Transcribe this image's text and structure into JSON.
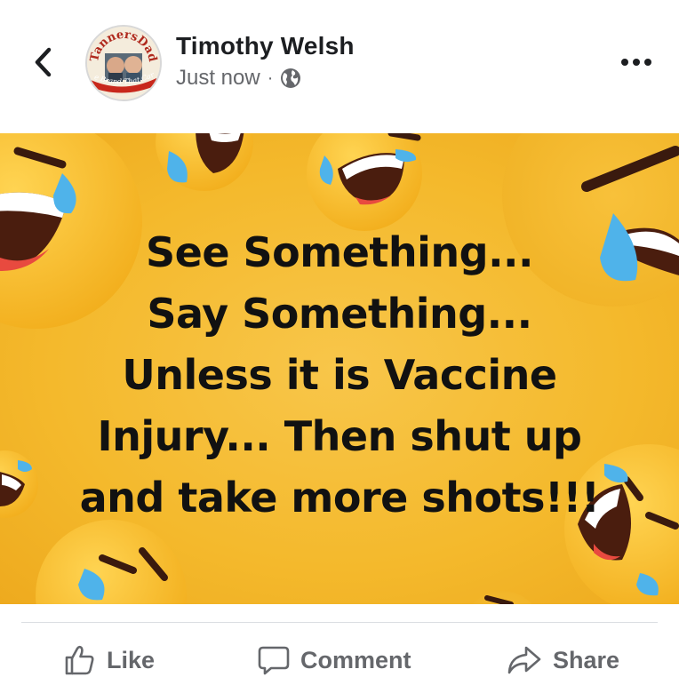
{
  "post": {
    "author": {
      "name": "Timothy Welsh"
    },
    "avatar": {
      "logo_top_text": "TannersDad",
      "logo_bottom_text": "The Brand That Cares"
    },
    "meta": {
      "time": "Just now",
      "separator": "·",
      "audience_icon": "globe-icon"
    },
    "image": {
      "caption_lines": [
        "See Something...",
        "Say Something...",
        "Unless it is Vaccine",
        "Injury... Then shut up",
        "and take more shots!!!"
      ],
      "background_color": "#F4B92C",
      "emoji": "laughing-crying-emoji"
    },
    "actions": {
      "like": {
        "label": "Like",
        "icon": "thumbs-up-icon"
      },
      "comment": {
        "label": "Comment",
        "icon": "comment-bubble-icon"
      },
      "share": {
        "label": "Share",
        "icon": "share-arrow-icon"
      }
    }
  },
  "icons": {
    "back": "chevron-left-icon",
    "more": "more-options-icon"
  },
  "colors": {
    "text_primary": "#1C1E21",
    "text_secondary": "#65676B",
    "divider": "#DADDE1",
    "image_yellow": "#F4B92C"
  }
}
